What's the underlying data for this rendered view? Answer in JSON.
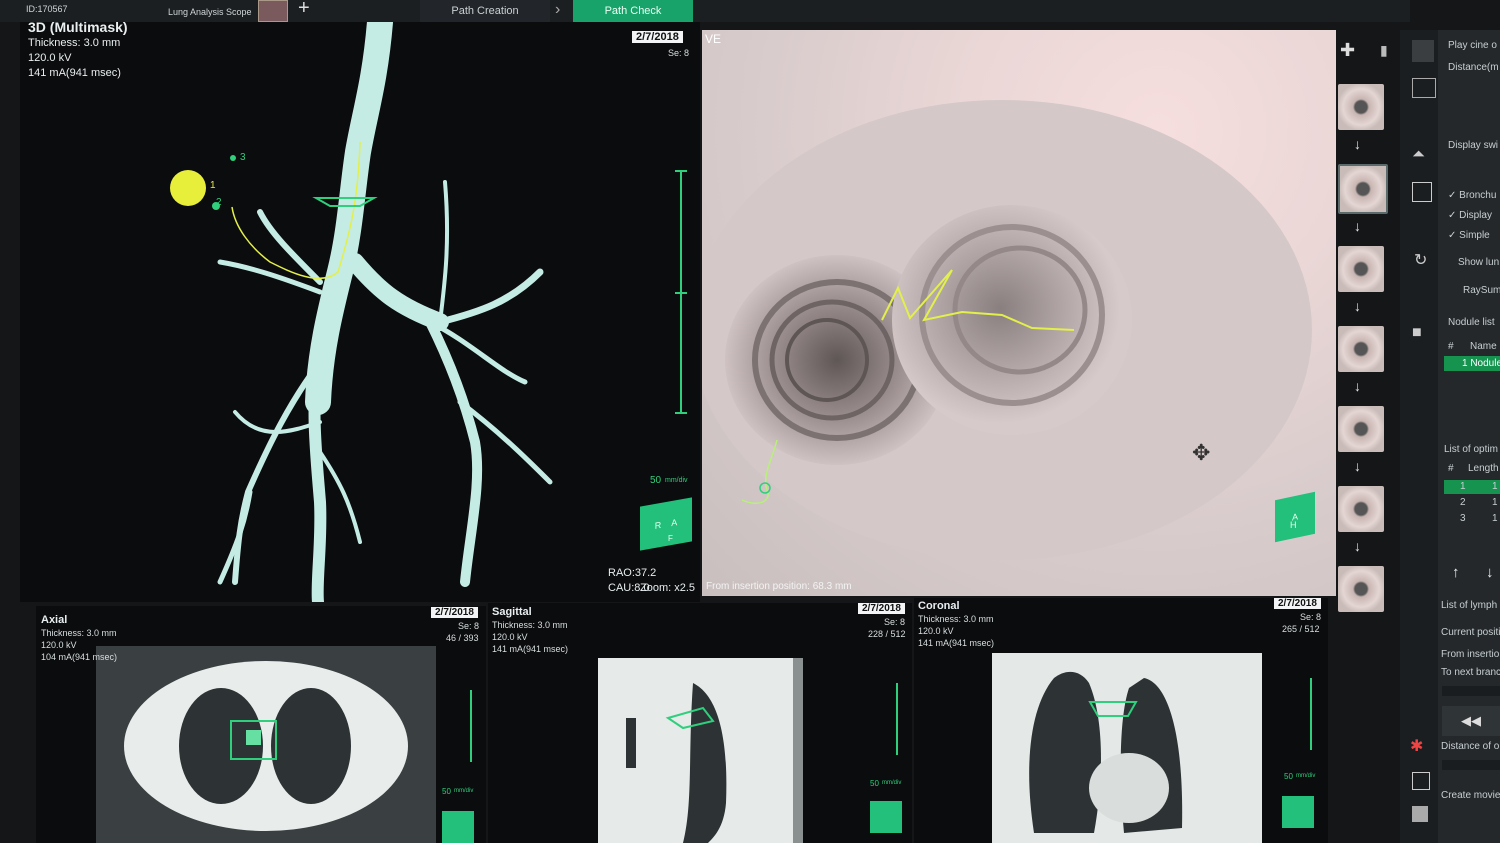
{
  "topbar": {
    "id_label": "ID:170567",
    "scope_label": "Lung Analysis Scope",
    "step_path_creation": "Path Creation",
    "step_path_check": "Path Check",
    "add_symbol": "+",
    "chevron": "›"
  },
  "view3d": {
    "title": "3D (Multimask)",
    "thickness": "Thickness: 3.0 mm",
    "kv": "120.0 kV",
    "ma": "141 mA(941 msec)",
    "marker_1": "1",
    "marker_2": "2",
    "marker_3": "3",
    "date": "2/7/2018",
    "series": "Se: 8",
    "scale": "50",
    "scale_unit": "mm/div",
    "orientation": "RAO:37.2 CAU:8.0",
    "zoom": "Zoom: x2.5",
    "cube_r": "R",
    "cube_a": "A",
    "cube_f": "F"
  },
  "ve": {
    "label": "VE",
    "footer": "From insertion position: 68.3 mm",
    "cube_a": "A",
    "cube_h": "H"
  },
  "axial": {
    "title": "Axial",
    "thickness": "Thickness: 3.0 mm",
    "kv": "120.0 kV",
    "ma": "104 mA(941 msec)",
    "date": "2/7/2018",
    "series": "Se: 8",
    "slice": "46 / 393",
    "scale": "50",
    "scale_unit": "mm/div"
  },
  "sagittal": {
    "title": "Sagittal",
    "thickness": "Thickness: 3.0 mm",
    "kv": "120.0 kV",
    "ma": "141 mA(941 msec)",
    "date": "2/7/2018",
    "series": "Se: 8",
    "slice": "228 / 512",
    "scale": "50",
    "scale_unit": "mm/div"
  },
  "coronal": {
    "title": "Coronal",
    "thickness": "Thickness: 3.0 mm",
    "kv": "120.0 kV",
    "ma": "141 mA(941 msec)",
    "date": "2/7/2018",
    "series": "Se: 8",
    "slice": "265 / 512",
    "scale": "50",
    "scale_unit": "mm/div"
  },
  "right_panel": {
    "play_cine": "Play cine o",
    "distance": "Distance(m",
    "display_switch": "Display swi",
    "check_bronchus": "Bronchu",
    "check_display": "Display",
    "check_simple": "Simple",
    "show_lung": "Show lun",
    "raysum": "RaySum",
    "nodule_list": "Nodule list",
    "col_hash": "#",
    "col_name": "Name",
    "nodule_row": "1  Nodule",
    "optimal_list": "List of optim",
    "col_length": "Length",
    "opt_rows": [
      "1",
      "2",
      "3"
    ],
    "opt_vals": [
      "1",
      "1",
      "1"
    ],
    "lymph_list": "List of lymph",
    "current_position": "Current positi",
    "from_insertion": "From insertion",
    "to_next_branch": "To next branc",
    "distance_of": "Distance of on",
    "create_movie": "Create movie f"
  },
  "colors": {
    "accent_green": "#18a36a",
    "airway_cyan": "#bfe9e3",
    "path_yellow": "#e3ef4a",
    "scale_green": "#2fcf7d"
  }
}
